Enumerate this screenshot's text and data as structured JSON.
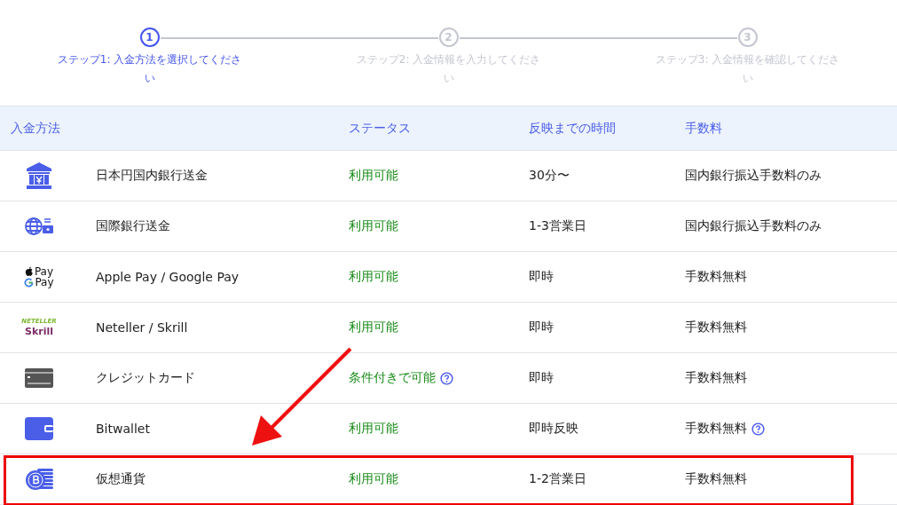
{
  "steps": [
    {
      "number": "1",
      "label": "ステップ1: 入金方法を選択してください",
      "selected": true
    },
    {
      "number": "2",
      "label": "ステップ2: 入金情報を入力してください",
      "selected": false
    },
    {
      "number": "3",
      "label": "ステップ3: 入金情報を確認してください",
      "selected": false
    }
  ],
  "table": {
    "columns": [
      "入金方法",
      "ステータス",
      "反映までの時間",
      "手数料"
    ],
    "rows": [
      {
        "kind": "bank",
        "name": "日本円国内銀行送金",
        "status": "利用可能",
        "status_help": false,
        "time": "30分〜",
        "fee": "国内銀行振込手数料のみ",
        "fee_help": false,
        "highlighted": false
      },
      {
        "kind": "intl",
        "name": "国際銀行送金",
        "status": "利用可能",
        "status_help": false,
        "time": "1-3営業日",
        "fee": "国内銀行振込手数料のみ",
        "fee_help": false,
        "highlighted": false
      },
      {
        "kind": "pay",
        "logo": [
          "Pay",
          "Pay"
        ],
        "name": "Apple Pay / Google Pay",
        "status": "利用可能",
        "status_help": false,
        "time": "即時",
        "fee": "手数料無料",
        "fee_help": false,
        "highlighted": false
      },
      {
        "kind": "ewallet",
        "logo": [
          "NETELLER",
          "Skrill"
        ],
        "name": "Neteller / Skrill",
        "status": "利用可能",
        "status_help": false,
        "time": "即時",
        "fee": "手数料無料",
        "fee_help": false,
        "highlighted": false
      },
      {
        "kind": "card",
        "name": "クレジットカード",
        "status": "条件付きで可能",
        "status_help": true,
        "time": "即時",
        "fee": "手数料無料",
        "fee_help": false,
        "highlighted": false
      },
      {
        "kind": "wallet",
        "name": "Bitwallet",
        "status": "利用可能",
        "status_help": false,
        "time": "即時反映",
        "fee": "手数料無料",
        "fee_help": true,
        "highlighted": false
      },
      {
        "kind": "crypto",
        "name": "仮想通貨",
        "status": "利用可能",
        "status_help": false,
        "time": "1-2営業日",
        "fee": "手数料無料",
        "fee_help": false,
        "highlighted": true
      }
    ]
  },
  "annotation": {
    "arrow": true
  }
}
